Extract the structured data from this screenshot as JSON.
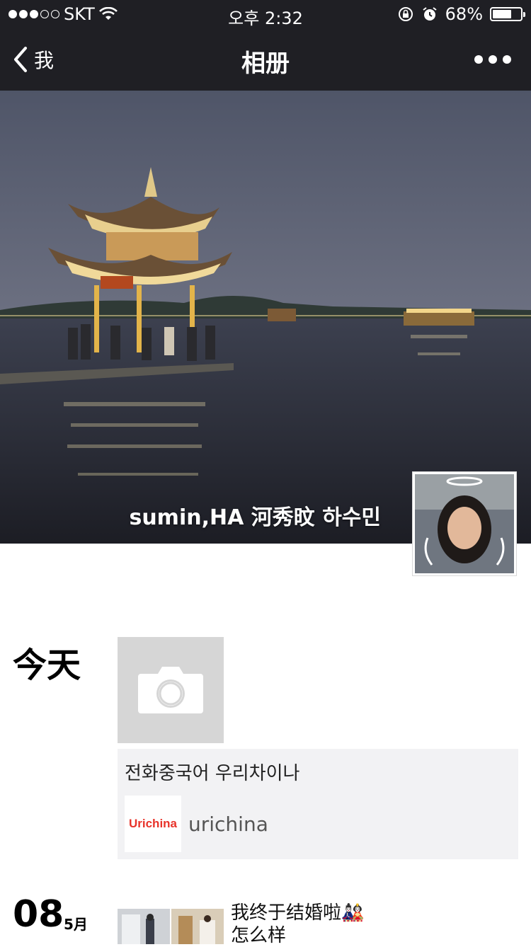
{
  "status_bar": {
    "carrier": "SKT",
    "time": "오후 2:32",
    "battery": "68%",
    "battery_level": 0.68,
    "signal_dots_filled": 3,
    "signal_dots_total": 5
  },
  "nav": {
    "back_label": "我",
    "title": "相册"
  },
  "cover": {
    "name": "sumin,HA 河秀旼 하수민"
  },
  "timeline": {
    "today_label": "今天",
    "shared_post": {
      "text": "전화중국어 우리차이나",
      "logo_text": "Urichina",
      "source_name": "urichina"
    },
    "entry": {
      "day": "08",
      "month": "5月",
      "text": "我终于结婚啦🎎\n怎么样"
    }
  },
  "colors": {
    "bar_background": "#1f1f24",
    "card_background": "#f2f2f4",
    "camera_tile": "#d6d6d6",
    "logo_red": "#e8332a"
  }
}
